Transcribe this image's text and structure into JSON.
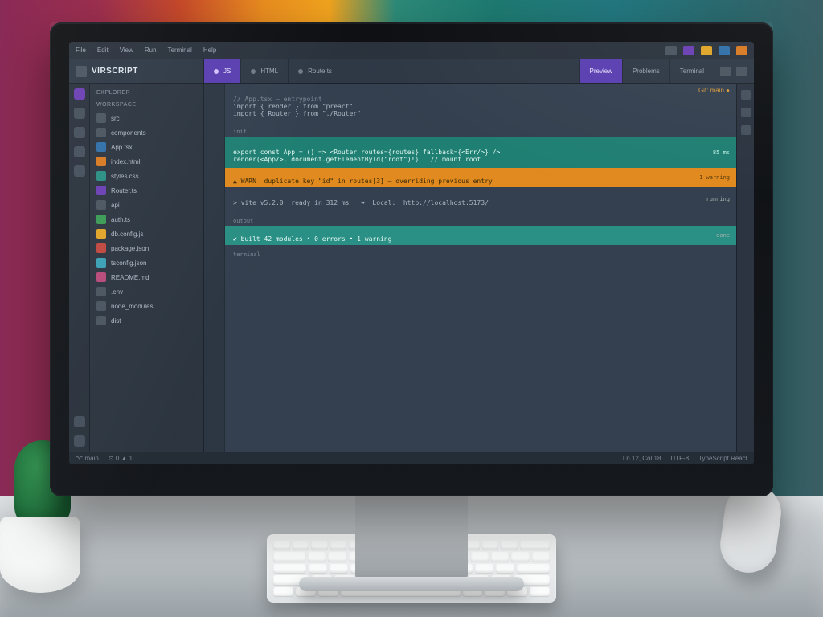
{
  "menubar": {
    "items": [
      "File",
      "Edit",
      "View",
      "Run",
      "Terminal",
      "Help"
    ]
  },
  "brand": "VIRSCRIPT",
  "tabs": {
    "left": [
      {
        "label": "JS",
        "active": true
      },
      {
        "label": "HTML",
        "active": false
      },
      {
        "label": "Route.ts",
        "active": false
      }
    ],
    "right": [
      {
        "label": "Preview"
      },
      {
        "label": "Problems"
      },
      {
        "label": "Terminal"
      }
    ]
  },
  "sidebar": {
    "heading1": "EXPLORER",
    "heading2": "WORKSPACE",
    "items": [
      {
        "label": "src",
        "color": "c-grey"
      },
      {
        "label": "components",
        "color": "c-grey"
      },
      {
        "label": "App.tsx",
        "color": "c-blue"
      },
      {
        "label": "index.html",
        "color": "c-orange"
      },
      {
        "label": "styles.css",
        "color": "c-teal"
      },
      {
        "label": "Router.ts",
        "color": "c-purple"
      },
      {
        "label": "api",
        "color": "c-grey"
      },
      {
        "label": "auth.ts",
        "color": "c-green"
      },
      {
        "label": "db.config.js",
        "color": "c-yellow"
      },
      {
        "label": "package.json",
        "color": "c-red"
      },
      {
        "label": "tsconfig.json",
        "color": "c-cyan"
      },
      {
        "label": "README.md",
        "color": "c-pink"
      },
      {
        "label": ".env",
        "color": "c-grey"
      },
      {
        "label": "node_modules",
        "color": "c-grey"
      },
      {
        "label": "dist",
        "color": "c-grey"
      }
    ]
  },
  "editor": {
    "corner": "Git: main ●",
    "seg0_hdr": "// App.tsx — entrypoint",
    "seg0_l1": "import { render } from \"preact\"",
    "seg0_l2": "import { Router } from \"./Router\"",
    "lbl1": "init",
    "teal_l1": "export const App = () => <Router routes={routes} fallback={<Err/>} />",
    "teal_l2": "render(<App/>, document.getElementById(\"root\")!)   // mount root",
    "teal_pill": "85 ms",
    "orange_l1": "▲ WARN  duplicate key \"id\" in routes[3] — overriding previous entry",
    "orange_pill": "1 warning",
    "dark_l1": "> vite v5.2.0  ready in 312 ms   ➜  Local:  http://localhost:5173/",
    "dark_pill": "running",
    "lbl2": "output",
    "teal2_l1": "✔ built 42 modules • 0 errors • 1 warning",
    "teal2_pill": "done",
    "lbl3": "terminal"
  },
  "status": {
    "left1": "⌥ main",
    "left2": "⊙ 0  ▲ 1",
    "right1": "Ln 12, Col 18",
    "right2": "UTF-8",
    "right3": "TypeScript React"
  }
}
